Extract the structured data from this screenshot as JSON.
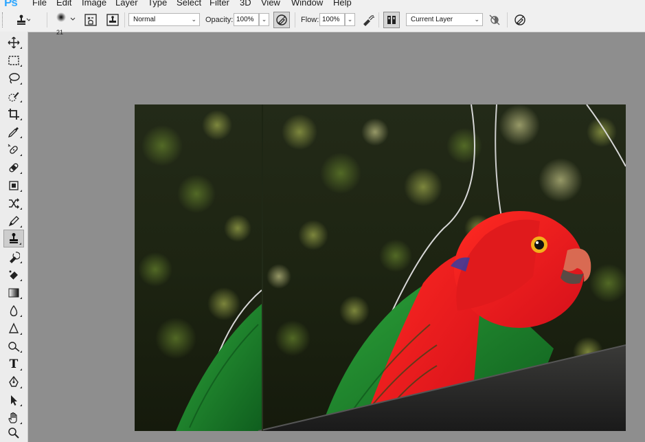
{
  "app": {
    "logo": "Ps"
  },
  "menu": [
    "File",
    "Edit",
    "Image",
    "Layer",
    "Type",
    "Select",
    "Filter",
    "3D",
    "View",
    "Window",
    "Help"
  ],
  "options_bar": {
    "brush_size": "21",
    "mode_label": "Normal",
    "opacity_label": "Opacity:",
    "opacity_value": "100%",
    "flow_label": "Flow:",
    "flow_value": "100%",
    "sample_label": "Current Layer"
  },
  "toolbar": {
    "tools": [
      {
        "name": "move-tool",
        "icon": "move-icon"
      },
      {
        "name": "rectangular-marquee-tool",
        "icon": "marquee-icon"
      },
      {
        "name": "lasso-tool",
        "icon": "lasso-icon"
      },
      {
        "name": "quick-selection-tool",
        "icon": "quick-selection-icon"
      },
      {
        "name": "crop-tool",
        "icon": "crop-icon"
      },
      {
        "name": "eyedropper-tool",
        "icon": "eyedropper-icon"
      },
      {
        "name": "spot-healing-tool",
        "icon": "spot-healing-icon"
      },
      {
        "name": "healing-brush-tool",
        "icon": "bandage-icon"
      },
      {
        "name": "patch-tool",
        "icon": "patch-icon"
      },
      {
        "name": "content-aware-move-tool",
        "icon": "content-aware-move-icon"
      },
      {
        "name": "brush-tool",
        "icon": "brush-icon"
      },
      {
        "name": "clone-stamp-tool",
        "icon": "clone-stamp-icon",
        "active": true
      },
      {
        "name": "history-brush-tool",
        "icon": "history-brush-icon"
      },
      {
        "name": "eraser-tool",
        "icon": "eraser-icon"
      },
      {
        "name": "gradient-tool",
        "icon": "gradient-icon"
      },
      {
        "name": "blur-tool",
        "icon": "blur-icon"
      },
      {
        "name": "sharpen-tool",
        "icon": "sharpen-icon"
      },
      {
        "name": "dodge-tool",
        "icon": "dodge-icon"
      },
      {
        "name": "type-tool",
        "icon": "type-icon",
        "glyph": "T"
      },
      {
        "name": "pen-tool",
        "icon": "pen-icon"
      },
      {
        "name": "path-selection-tool",
        "icon": "arrow-icon"
      },
      {
        "name": "hand-tool",
        "icon": "hand-icon"
      },
      {
        "name": "zoom-tool",
        "icon": "zoom-icon"
      }
    ]
  },
  "colors": {
    "ui_bg": "#f0f0f0",
    "workspace": "#8e8e8e",
    "parrot_red": "#e8181c",
    "parrot_green": "#1f8a2c"
  }
}
